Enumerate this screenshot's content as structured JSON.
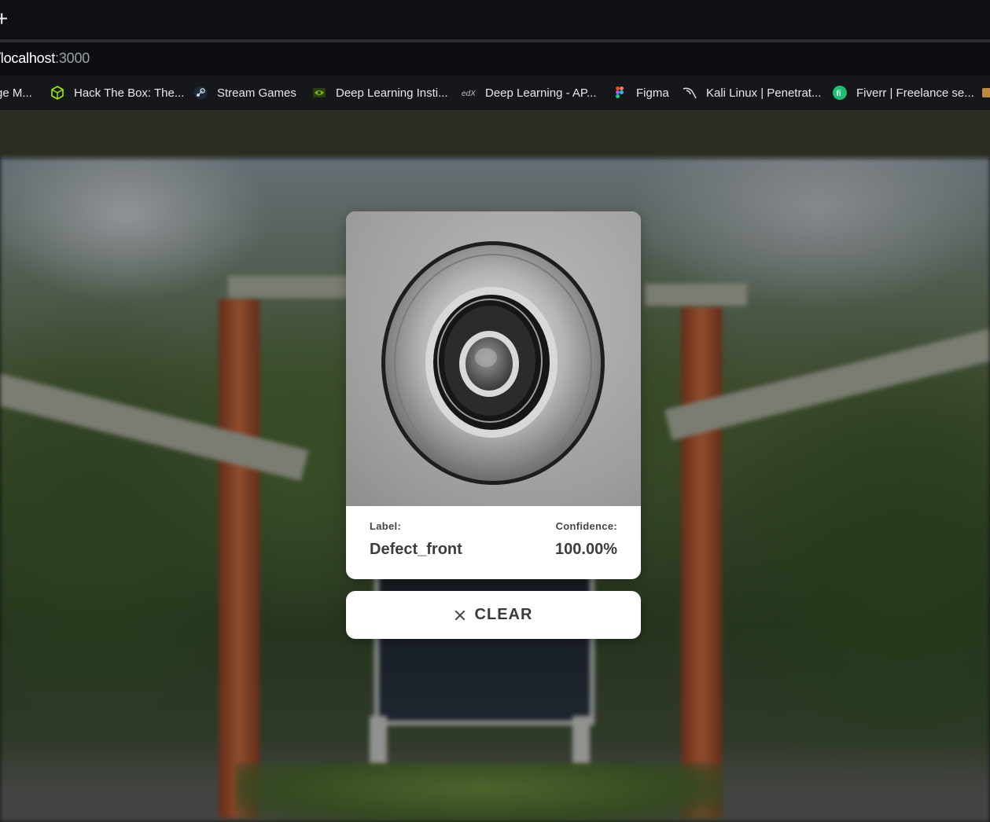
{
  "browser": {
    "url_host": "/localhost",
    "url_port": ":3000",
    "bookmarks": [
      {
        "label": "ge M...",
        "icon": "bookmark-icon"
      },
      {
        "label": "Hack The Box: The...",
        "icon": "hackthebox-cube-icon"
      },
      {
        "label": "Stream Games",
        "icon": "steam-icon"
      },
      {
        "label": "Deep Learning Insti...",
        "icon": "nvidia-icon"
      },
      {
        "label": "Deep Learning - AP...",
        "icon": "edx-icon"
      },
      {
        "label": "Figma",
        "icon": "figma-icon"
      },
      {
        "label": "Kali Linux | Penetrat...",
        "icon": "kali-dragon-icon"
      },
      {
        "label": "Fiverr | Freelance se...",
        "icon": "fiverr-icon"
      }
    ]
  },
  "result": {
    "label_title": "Label:",
    "label_value": "Defect_front",
    "confidence_title": "Confidence:",
    "confidence_value": "100.00%"
  },
  "clear_button": {
    "label": "CLEAR",
    "icon": "close-icon"
  },
  "colors": {
    "card_bg": "#ffffff",
    "text": "#3c3c3c",
    "header_bar": "#2c2c22",
    "browser_bg": "#0e1016"
  }
}
